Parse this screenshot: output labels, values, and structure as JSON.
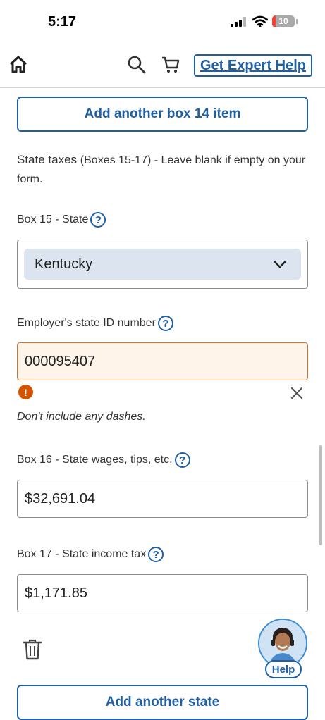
{
  "status": {
    "time": "5:17",
    "battery": "10"
  },
  "nav": {
    "expert_help": "Get Expert Help"
  },
  "add_box14": "Add another box 14 item",
  "state_section": {
    "heading_main": "State taxes",
    "heading_detail": "(Boxes 15-17) - Leave blank if empty on your form."
  },
  "box15": {
    "label": "Box 15 - State",
    "value": "Kentucky"
  },
  "employer_id": {
    "label": "Employer's state ID number",
    "value": "000095407",
    "error": "Don't include any dashes."
  },
  "box16": {
    "label": "Box 16 - State wages, tips, etc.",
    "value": "$32,691.04"
  },
  "box17": {
    "label": "Box 17 - State income tax",
    "value": "$1,171.85"
  },
  "help": {
    "label": "Help"
  },
  "help_q": "?",
  "add_state": "Add another state",
  "icons": [
    "home-icon",
    "search-icon",
    "cart-icon",
    "chevron-down-icon",
    "alert-icon",
    "close-icon",
    "trash-icon",
    "help-icon"
  ],
  "colors": {
    "accent": "#1f5fa6",
    "error": "#d35400",
    "error_bg": "#fef4ea",
    "select_bg": "#dbe4ef"
  }
}
